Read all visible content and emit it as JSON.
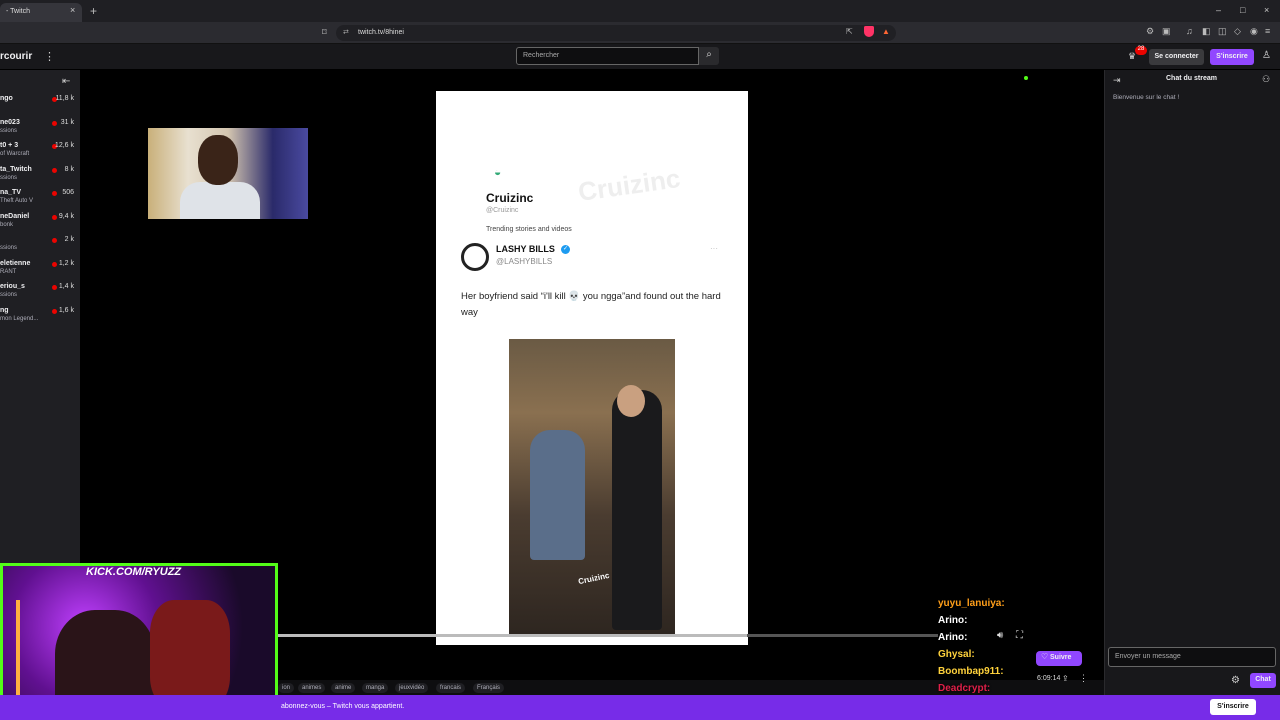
{
  "browser": {
    "tab_title": "- Twitch",
    "tab_close": "×",
    "new_tab": "+",
    "window_controls": [
      "–",
      "□",
      "×"
    ],
    "url": "twitch.tv/8hinei",
    "icons": [
      "bookmark-icon",
      "lock-icon",
      "share-icon",
      "brave-shield-icon",
      "rewards-icon",
      "extensions-icon",
      "menu-icon"
    ]
  },
  "topbar": {
    "browse_label": "rcourir",
    "more": "⋮",
    "search_placeholder": "Rechercher",
    "notification_count": "28",
    "login_label": "Se connecter",
    "signup_label": "S'inscrire"
  },
  "sidebar": {
    "channels": [
      {
        "name": "ngo",
        "game": "",
        "viewers": "11,8 k"
      },
      {
        "name": "ne023",
        "game": "ssions",
        "viewers": "31 k"
      },
      {
        "name": "t0 + 3",
        "game": "of Warcraft",
        "viewers": "12,6 k"
      },
      {
        "name": "ta_Twitch",
        "game": "ssions",
        "viewers": "8 k"
      },
      {
        "name": "na_TV",
        "game": "Theft Auto V",
        "viewers": "506"
      },
      {
        "name": "neDaniel",
        "game": "bonk",
        "viewers": "9,4 k"
      },
      {
        "name": "",
        "game": "ssions",
        "viewers": "2 k"
      },
      {
        "name": "eletienne",
        "game": "RANT",
        "viewers": "1,2 k"
      },
      {
        "name": "eriou_s",
        "game": "ssions",
        "viewers": "1,4 k"
      },
      {
        "name": "ng",
        "game": "mon Legend...",
        "viewers": "1,6 k"
      }
    ]
  },
  "tweet": {
    "brand": "Cruizinc",
    "brand_handle": "@Cruizinc",
    "tagline": "Trending stories and videos",
    "author": "LASHY BILLS",
    "handle": "@LASHYBILLS",
    "text": "Her boyfriend said “i'll  kill 💀 you ngga”and found out the hard way",
    "video_watermark": "Cruizinc",
    "more": "···"
  },
  "cam2": {
    "overlay": "KICK.COM/RYUZZ"
  },
  "tags": [
    "ion",
    "animes",
    "anime",
    "manga",
    "jeuxvidéo",
    "francais",
    "Français"
  ],
  "video_chat": [
    {
      "user": "yuyu_lanuiya:",
      "color": "#ff9f1a"
    },
    {
      "user": "Arino:",
      "color": "#ffffff"
    },
    {
      "user": "Arino:",
      "color": "#ffffff"
    },
    {
      "user": "Ghysal:",
      "color": "#ffd23c"
    },
    {
      "user": "Boombap911:",
      "color": "#ffd23c"
    },
    {
      "user": "Deadcrypt:",
      "color": "#e0204a"
    }
  ],
  "player": {
    "follow_label": "Suivre",
    "uptime": "6:09:14",
    "progress": 0.71
  },
  "chat": {
    "title": "Chat du stream",
    "welcome": "Bienvenue sur le chat !",
    "input_placeholder": "Envoyer un message",
    "chat_button": "Chat"
  },
  "banner": {
    "text": "abonnez-vous – Twitch vous appartient.",
    "button": "S'inscrire"
  },
  "colors": {
    "accent": "#9147ff",
    "live": "#eb0400",
    "kick": "#53fc18",
    "banner": "#772ce8"
  }
}
